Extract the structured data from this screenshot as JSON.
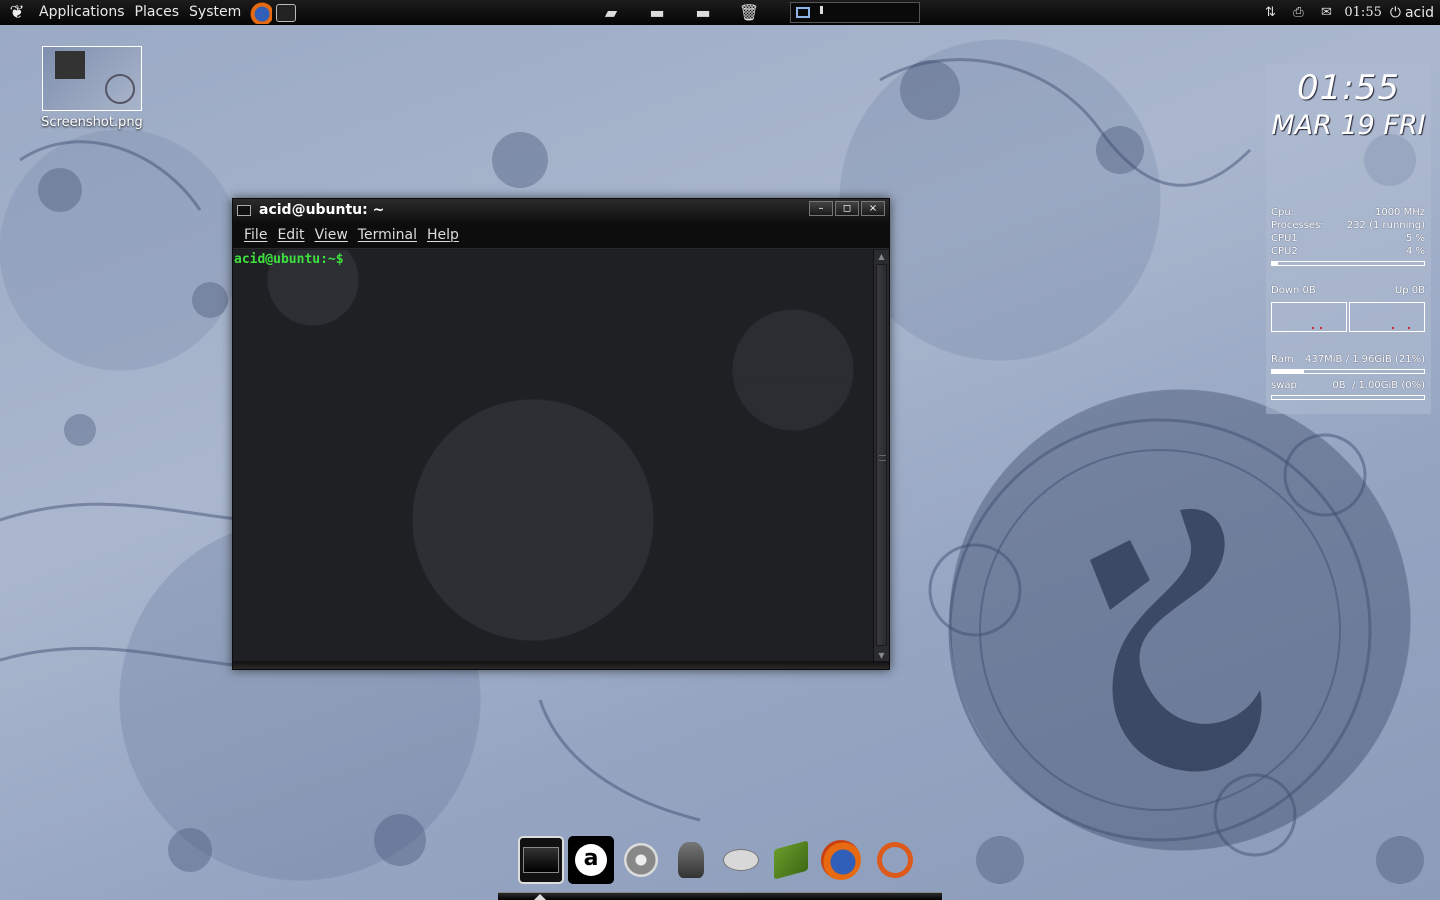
{
  "top_panel": {
    "menus": [
      "Applications",
      "Places",
      "System"
    ],
    "launchers": [
      "firefox-icon",
      "terminal-icon"
    ],
    "drives": [
      "drive-icon",
      "drive-icon",
      "drive-icon",
      "trash-icon"
    ],
    "tray_icons": [
      "network-icon",
      "printer-icon",
      "mail-icon"
    ],
    "clock": "01:55",
    "user": "acid"
  },
  "desktop": {
    "icon_label": "Screenshot.png"
  },
  "terminal": {
    "title": "acid@ubuntu: ~",
    "menus": [
      "File",
      "Edit",
      "View",
      "Terminal",
      "Help"
    ],
    "prompt": "acid@ubuntu:~$",
    "buttons": {
      "minimize": "–",
      "maximize": "◻",
      "close": "×"
    }
  },
  "conky": {
    "time": "01:55",
    "date": "MAR 19 FRI",
    "cpu_label": "Cpu:",
    "cpu_value": "1000 MHz",
    "processes_label": "Processes:",
    "processes_value": "232 (1 running)",
    "cpu1_label": "CPU1",
    "cpu1_value": "5 %",
    "cpu2_label": "CPU2",
    "cpu2_value": "4 %",
    "cpu_usage_fraction": 0.04,
    "down_label": "Down 0B",
    "up_label": "Up 0B",
    "ram_label": "Ram",
    "ram_value": "437MiB / 1.96GiB (21%)",
    "ram_fraction": 0.21,
    "swap_label": "swap",
    "swap_used": "0B",
    "swap_value": "/ 1.00GiB (0%)",
    "swap_fraction": 0.0
  },
  "dock": {
    "items": [
      "terminal-icon",
      "avant-icon",
      "media-player-icon",
      "mascot-icon",
      "gimp-icon",
      "book-icon",
      "firefox-icon",
      "ubuntu-icon"
    ]
  },
  "colors": {
    "prompt_green": "#3ee03e",
    "panel_black": "#0a0a0a",
    "wallpaper_blue": "#9aa9c4",
    "dragon_navy": "#2f3c58"
  }
}
